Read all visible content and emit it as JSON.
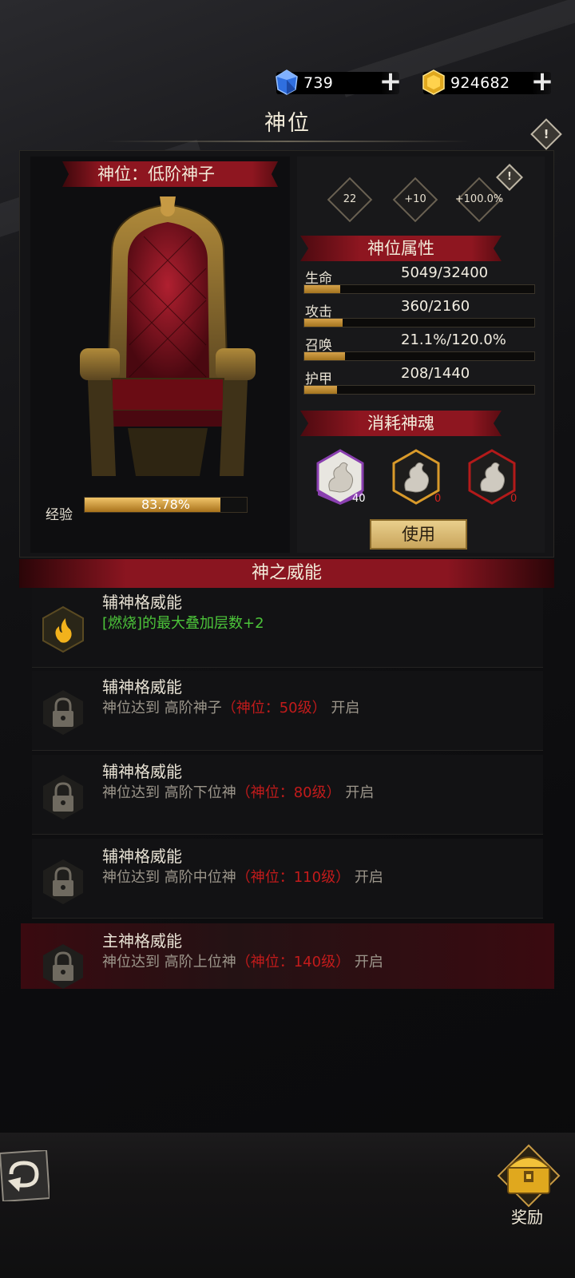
{
  "currency": {
    "gems": "739",
    "gold": "924682"
  },
  "page": {
    "title": "神位"
  },
  "rank": {
    "label": "神位：低阶神子",
    "diamonds": [
      "22",
      "+10",
      "+100.0%"
    ]
  },
  "exp": {
    "label": "经验",
    "percent_text": "83.78%",
    "fraction": 0.8378
  },
  "attributes": {
    "header": "神位属性",
    "items": [
      {
        "label": "生命",
        "value": "5049/32400",
        "fraction": 0.156
      },
      {
        "label": "攻击",
        "value": "360/2160",
        "fraction": 0.167
      },
      {
        "label": "召唤",
        "value": "21.1%/120.0%",
        "fraction": 0.176
      },
      {
        "label": "护甲",
        "value": "208/1440",
        "fraction": 0.144
      }
    ]
  },
  "souls": {
    "header": "消耗神魂",
    "items": [
      {
        "count": "40",
        "color": "#8a3fb0"
      },
      {
        "count": "0",
        "color": "#d99a2a"
      },
      {
        "count": "0",
        "color": "#b31a1a"
      }
    ],
    "use_label": "使用"
  },
  "power": {
    "header": "神之威能",
    "rows": [
      {
        "title": "辅神格威能",
        "desc": "[燃烧]的最大叠加层数+2",
        "unlocked": true
      },
      {
        "title": "辅神格威能",
        "desc_pre": "神位达到 高阶神子",
        "desc_red": "（神位：50级）",
        "desc_post": " 开启",
        "unlocked": false
      },
      {
        "title": "辅神格威能",
        "desc_pre": "神位达到 高阶下位神",
        "desc_red": "（神位：80级）",
        "desc_post": " 开启",
        "unlocked": false
      },
      {
        "title": "辅神格威能",
        "desc_pre": "神位达到 高阶中位神",
        "desc_red": "（神位：110级）",
        "desc_post": " 开启",
        "unlocked": false
      },
      {
        "title": "主神格威能",
        "desc_pre": "神位达到 高阶上位神",
        "desc_red": "（神位：140级）",
        "desc_post": " 开启",
        "unlocked": false
      }
    ]
  },
  "footer": {
    "reward_label": "奖励"
  }
}
